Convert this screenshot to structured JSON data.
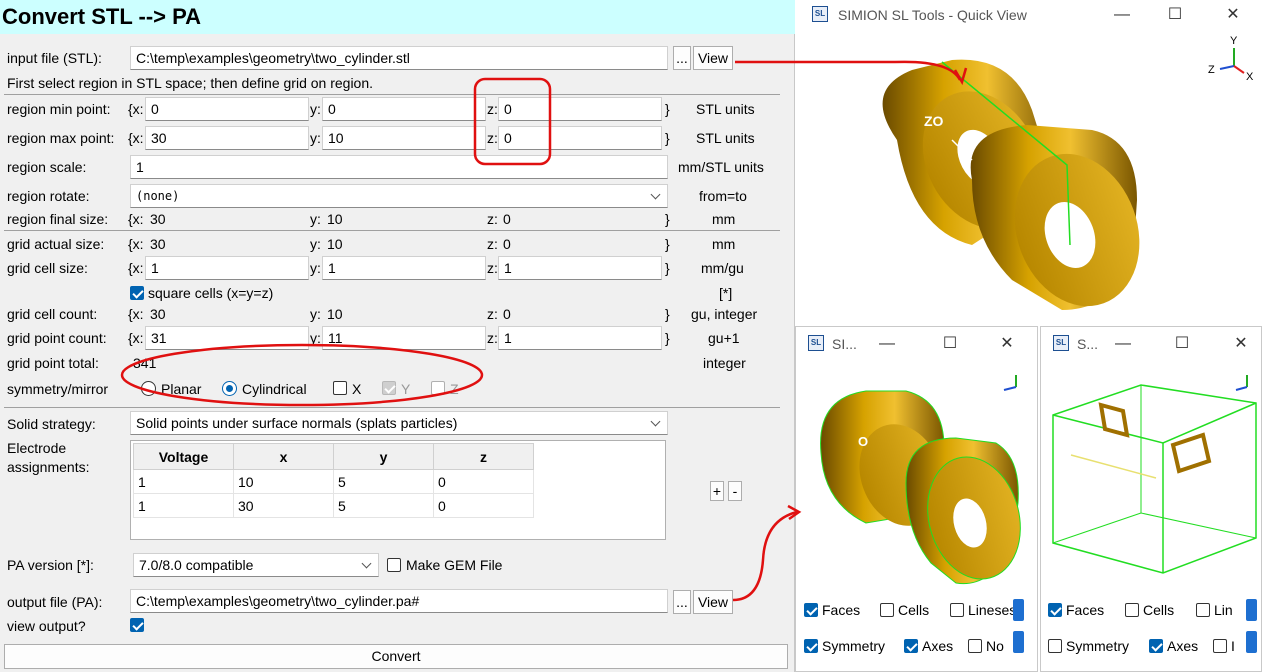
{
  "main": {
    "title": "Convert STL --> PA",
    "input_label": "input file (STL):",
    "input_value": "C:\\temp\\examples\\geometry\\two_cylinder.stl",
    "browse": "...",
    "view": "View",
    "hint": "First select region in STL space; then define grid on region.",
    "rows": {
      "min_label": "region min point:",
      "min_x": "0",
      "min_y": "0",
      "min_z": "0",
      "min_unit": "STL units",
      "max_label": "region max point:",
      "max_x": "30",
      "max_y": "10",
      "max_z": "0",
      "max_unit": "STL units",
      "scale_label": "region scale:",
      "scale_value": "1",
      "scale_unit": "mm/STL units",
      "rotate_label": "region rotate:",
      "rotate_value": "(none)",
      "rotate_unit": "from=to",
      "final_label": "region final size:",
      "final_x": "30",
      "final_y": "10",
      "final_z": "0",
      "final_unit": "mm",
      "actual_label": "grid actual size:",
      "actual_x": "30",
      "actual_y": "10",
      "actual_z": "0",
      "actual_unit": "mm",
      "cell_label": "grid cell size:",
      "cell_x": "1",
      "cell_y": "1",
      "cell_z": "1",
      "cell_unit": "mm/gu",
      "square_label": "square cells (x=y=z)",
      "square_unit": "[*]",
      "count_label": "grid cell count:",
      "count_x": "30",
      "count_y": "10",
      "count_z": "0",
      "count_unit": "gu, integer",
      "pcount_label": "grid point count:",
      "pcount_x": "31",
      "pcount_y": "11",
      "pcount_z": "1",
      "pcount_unit": "gu+1",
      "total_label": "grid point total:",
      "total_value": "341",
      "total_unit": "integer",
      "sym_label": "symmetry/mirror",
      "planar": "Planar",
      "cylindrical": "Cylindrical",
      "mx": "X",
      "my": "Y",
      "mz": "Z"
    },
    "brace_x": "{x:",
    "y_prefix": "y:",
    "z_prefix": "z:",
    "brace_close": "}",
    "solid_label": "Solid strategy:",
    "solid_value": "Solid points under surface normals (splats particles)",
    "electrode_label_1": "Electrode",
    "electrode_label_2": "assignments:",
    "table": {
      "headers": [
        "Voltage",
        "x",
        "y",
        "z"
      ],
      "rows": [
        [
          "1",
          "10",
          "5",
          "0"
        ],
        [
          "1",
          "30",
          "5",
          "0"
        ]
      ]
    },
    "plus": "+",
    "minus": "-",
    "pa_label": "PA version [*]:",
    "pa_value": "7.0/8.0 compatible",
    "gem_label": "Make GEM File",
    "output_label": "output file (PA):",
    "output_value": "C:\\temp\\examples\\geometry\\two_cylinder.pa#",
    "view_output_label": "view output?",
    "convert": "Convert",
    "zo_mark": "ZO"
  },
  "quickview": {
    "title": "SIMION SL Tools - Quick View",
    "min": "—",
    "max": "☐",
    "close": "✕",
    "axis_y": "Y",
    "axis_z": "Z",
    "axis_x": "X"
  },
  "win2": {
    "title": "SI...",
    "faces": "Faces",
    "cells": "Cells",
    "lines": "Lineses",
    "symmetry": "Symmetry",
    "axes": "Axes",
    "extra": "No",
    "o_mark": "O"
  },
  "win3": {
    "title": "S...",
    "faces": "Faces",
    "cells": "Cells",
    "lines": "Lin",
    "symmetry": "Symmetry",
    "axes": "Axes",
    "extra": "I"
  },
  "colors": {
    "accent": "#0063b1",
    "title_bg": "#ccffff",
    "annotation": "#e01010",
    "gold": "#c89400",
    "wire": "#22dd22"
  }
}
